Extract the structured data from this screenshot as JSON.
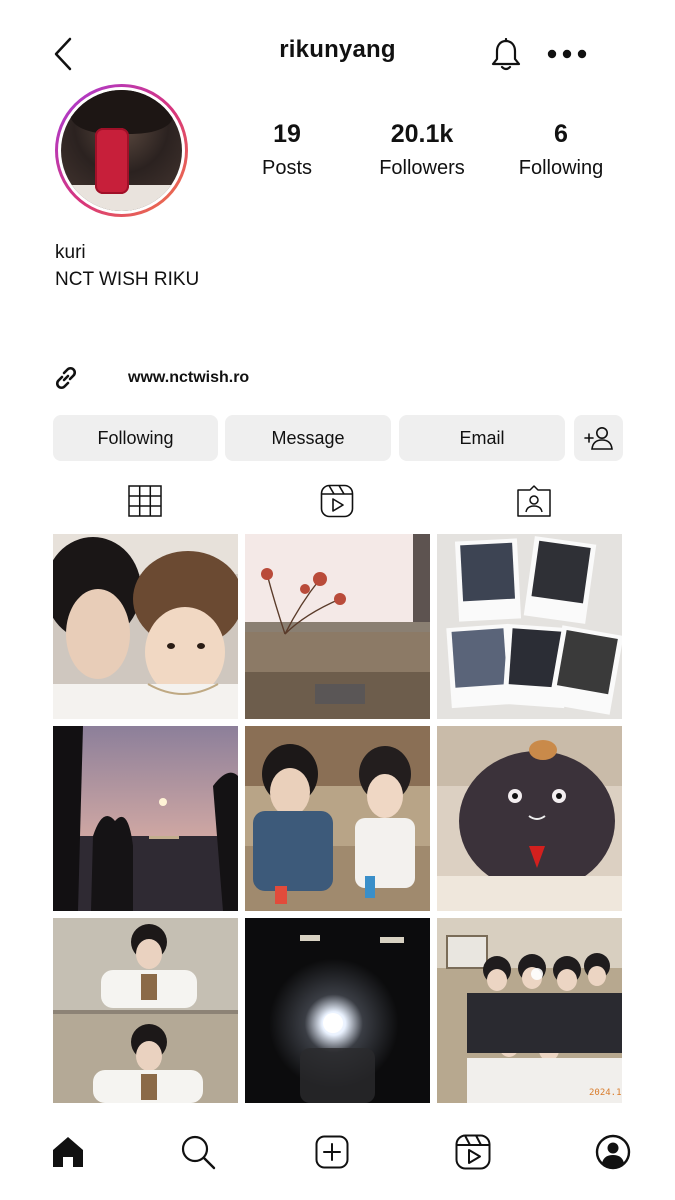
{
  "header": {
    "username": "rikunyang",
    "icons": {
      "back": "chevron-left-icon",
      "notifications": "bell-icon",
      "more": "more-horizontal-icon"
    }
  },
  "profile": {
    "stats": [
      {
        "value": "19",
        "label": "Posts"
      },
      {
        "value": "20.1k",
        "label": "Followers"
      },
      {
        "value": "6",
        "label": "Following"
      }
    ],
    "name": "kuri",
    "bio": "NCT WISH RIKU",
    "link": "www.nctwish.ro"
  },
  "actions": {
    "following_label": "Following",
    "message_label": "Message",
    "email_label": "Email"
  },
  "tabs": [
    {
      "icon": "grid-icon",
      "active": true
    },
    {
      "icon": "reels-icon",
      "active": false
    },
    {
      "icon": "tagged-icon",
      "active": false
    }
  ],
  "posts": {
    "count_shown": 9,
    "last_post_date_stamp": "2024.1"
  },
  "bottom_nav": [
    "home-icon",
    "search-icon",
    "create-icon",
    "reels-icon",
    "profile-icon"
  ],
  "colors": {
    "text": "#111111",
    "button_bg": "#efefef",
    "story_ring_start": "#a43bdb",
    "story_ring_end": "#f17e3f"
  }
}
